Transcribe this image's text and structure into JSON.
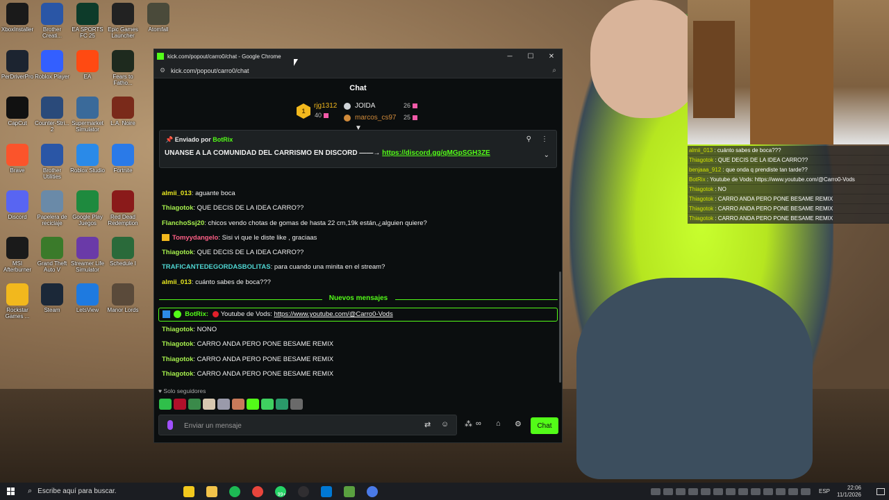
{
  "desktop": {
    "icons": [
      {
        "label": "XboxInstaller",
        "icon": "xbox-icon",
        "color": "#1a1a1a"
      },
      {
        "label": "Brother Creati...",
        "icon": "brother-icon",
        "color": "#2a56a6"
      },
      {
        "label": "EA SPORTS FC 25",
        "icon": "fc25-icon",
        "color": "#0d3b2a"
      },
      {
        "label": "Epic Games Launcher",
        "icon": "epic-icon",
        "color": "#222222"
      },
      {
        "label": "Atomfall",
        "icon": "atomfall-icon",
        "color": "#4a4a3a"
      },
      {
        "label": "PerDriverPro",
        "icon": "unreal-icon",
        "color": "#1c2430"
      },
      {
        "label": "Roblox Player",
        "icon": "roblox-icon",
        "color": "#335fff"
      },
      {
        "label": "EA",
        "icon": "ea-icon",
        "color": "#ff4a12"
      },
      {
        "label": "Fears to Fatho...",
        "icon": "f2f-icon",
        "color": "#1e2a1e"
      },
      {
        "label": "CapCut",
        "icon": "capcut-icon",
        "color": "#111111"
      },
      {
        "label": "Counter-Stri... 2",
        "icon": "cs2-icon",
        "color": "#2a4a7a"
      },
      {
        "label": "Supermarket Simulator",
        "icon": "supermarket-icon",
        "color": "#3a6a9a"
      },
      {
        "label": "L.A. Noire",
        "icon": "lanoire-icon",
        "color": "#7a2a1a"
      },
      {
        "label": "Brave",
        "icon": "brave-icon",
        "color": "#fb542b"
      },
      {
        "label": "Brother Utilities",
        "icon": "brother-utilities-icon",
        "color": "#2a56a6"
      },
      {
        "label": "Roblox Studio",
        "icon": "roblox-studio-icon",
        "color": "#2a8ae8"
      },
      {
        "label": "Fortnite",
        "icon": "fortnite-icon",
        "color": "#2a7ae8"
      },
      {
        "label": "Discord",
        "icon": "discord-icon",
        "color": "#5865f2"
      },
      {
        "label": "Papelera de reciclaje",
        "icon": "recycle-bin-icon",
        "color": "#6a8aa8"
      },
      {
        "label": "Google Play Juegos",
        "icon": "google-play-icon",
        "color": "#1e8a3e"
      },
      {
        "label": "Red Dead Redemption",
        "icon": "rdr-icon",
        "color": "#8a1a1a"
      },
      {
        "label": "MSI Afterburner",
        "icon": "msi-icon",
        "color": "#1a1a1a"
      },
      {
        "label": "Grand Theft Auto V",
        "icon": "gta-icon",
        "color": "#3a7a2a"
      },
      {
        "label": "Streamer Life Simulator",
        "icon": "streamer-life-icon",
        "color": "#6a3aa8"
      },
      {
        "label": "Schedule I",
        "icon": "schedule-icon",
        "color": "#2a6a3a"
      },
      {
        "label": "Rockstar Games ...",
        "icon": "rockstar-icon",
        "color": "#f2b81d"
      },
      {
        "label": "Steam",
        "icon": "steam-icon",
        "color": "#1b2838"
      },
      {
        "label": "LetsView",
        "icon": "letsview-icon",
        "color": "#1e7ae0"
      },
      {
        "label": "Manor Lords",
        "icon": "manor-lords-icon",
        "color": "#5a4a3a"
      }
    ]
  },
  "overlay_chat": [
    {
      "user": "almii_013",
      "text": ": cuánto sabes de boca???"
    },
    {
      "user": "Thiagotok",
      "text": ": QUE DECIS DE LA IDEA CARRO??"
    },
    {
      "user": "benjaaa_912",
      "text": ": que onda q prendiste tan tarde??"
    },
    {
      "user": "BotRix",
      "text": ": Youtube de Vods: https://www.youtube.com/@Carro0-Vods"
    },
    {
      "user": "Thiagotok",
      "text": ": NO"
    },
    {
      "user": "Thiagotok",
      "text": ": CARRO ANDA PERO PONE BESAME REMIX"
    },
    {
      "user": "Thiagotok",
      "text": ": CARRO ANDA PERO PONE BESAME REMIX"
    },
    {
      "user": "Thiagotok",
      "text": ": CARRO ANDA PERO PONE BESAME REMIX"
    }
  ],
  "window": {
    "title": "kick.com/popout/carro0/chat - Google Chrome",
    "url": "kick.com/popout/carro0/chat",
    "minimize": "─",
    "maximize": "☐",
    "close": "✕"
  },
  "chat": {
    "header": "Chat",
    "leaderboard": {
      "first": {
        "rank": "1",
        "name": "rjg1312",
        "points": "40"
      },
      "second": {
        "name": "JOIDA",
        "points": "26"
      },
      "third": {
        "name": "marcos_cs97",
        "points": "25"
      }
    },
    "pinned": {
      "sent_by": "Enviado por",
      "bot": "BotRix",
      "text": "UNANSE A LA COMUNIDAD DEL CARRISMO EN DISCORD ——→",
      "link": "https://discord.gg/qMGpSGH3ZE"
    },
    "messages": [
      {
        "user": "almii_013",
        "text": "aguante boca",
        "color": "c-yellow"
      },
      {
        "user": "Thiagotok",
        "text": "QUE DECIS DE LA IDEA CARRO??",
        "color": "c-lime"
      },
      {
        "user": "FlanchoSsj20",
        "text": "chicos vendo chotas de gomas de hasta 22 cm,19k están,¿alguien quiere?",
        "color": "c-lime"
      },
      {
        "user": "Tomyydangelo",
        "text": "Sisi vi que le diste like , graciaas",
        "color": "c-pink"
      },
      {
        "user": "Thiagotok",
        "text": "QUE DECIS DE LA IDEA CARRO??",
        "color": "c-lime"
      },
      {
        "user": "TRAFICANTEDEGORDASBOLITAS",
        "text": "para cuando una minita en el stream?",
        "color": "c-cyan"
      },
      {
        "user": "almii_013",
        "text": "cuánto sabes de boca???",
        "color": "c-yellow"
      }
    ],
    "new_messages": "Nuevos mensajes",
    "bot_message": {
      "user": "BotRix",
      "prefix": "Youtube de Vods:",
      "link": "https://www.youtube.com/@Carro0-Vods"
    },
    "messages_after": [
      {
        "user": "Thiagotok",
        "text": "NONO"
      },
      {
        "user": "Thiagotok",
        "text": "CARRO ANDA PERO PONE BESAME REMIX"
      },
      {
        "user": "Thiagotok",
        "text": "CARRO ANDA PERO PONE BESAME REMIX"
      },
      {
        "user": "Thiagotok",
        "text": "CARRO ANDA PERO PONE BESAME REMIX"
      }
    ],
    "followers_only": "Solo seguidores",
    "input_placeholder": "Enviar un mensaje",
    "send_label": "Chat",
    "accent": "#53fc18"
  },
  "taskbar": {
    "search_placeholder": "Escribe aquí para buscar.",
    "language": "ESP",
    "time": "22:06",
    "date": "11/1/2026",
    "badge": "99+"
  }
}
